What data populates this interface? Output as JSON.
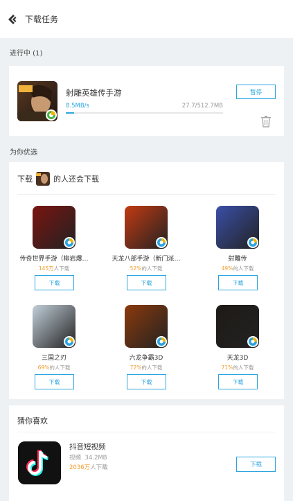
{
  "header": {
    "title": "下载任务",
    "back_icon": "back-arrow-icon"
  },
  "downloading": {
    "section_label": "进行中 (1)",
    "app_name": "射雕英雄传手游",
    "speed": "8.5MB/s",
    "size": "27.7/512.7MB",
    "progress": 0.054,
    "pause_label": "暂停",
    "icon": "game-icon",
    "delete_icon": "trash-icon"
  },
  "recommend": {
    "section_label": "为你优选",
    "title_prefix": "下载",
    "title_suffix": "的人还会下载",
    "apps": [
      {
        "name": "传奇世界手游（柳岩爆…",
        "count_hl": "145万",
        "count_suffix": "人下载",
        "button": "下载",
        "icon_color": "#7a1410"
      },
      {
        "name": "天龙八部手游（新门派…",
        "count_hl": "52%",
        "count_suffix": "的人下载",
        "button": "下载",
        "icon_color": "#c23a12"
      },
      {
        "name": "射雕传",
        "count_hl": "49%",
        "count_suffix": "的人下载",
        "button": "下载",
        "icon_color": "#3a4fa8"
      },
      {
        "name": "三国之刃",
        "count_hl": "69%",
        "count_suffix": "的人下载",
        "button": "下载",
        "icon_color": "#c2cfd9"
      },
      {
        "name": "六龙争霸3D",
        "count_hl": "72%",
        "count_suffix": "的人下载",
        "button": "下载",
        "icon_color": "#8b3a0c"
      },
      {
        "name": "天龙3D",
        "count_hl": "71%",
        "count_suffix": "的人下载",
        "button": "下载",
        "icon_color": "#1e1a16"
      }
    ]
  },
  "guess": {
    "title": "猜你喜欢",
    "app_name": "抖音短视频",
    "category": "视频",
    "size": "34.2MB",
    "count_hl": "2036万",
    "count_suffix": "人下载",
    "button": "下载"
  },
  "colors": {
    "accent": "#2aa4df",
    "highlight": "#f09b2c",
    "background": "#eef1f3"
  }
}
